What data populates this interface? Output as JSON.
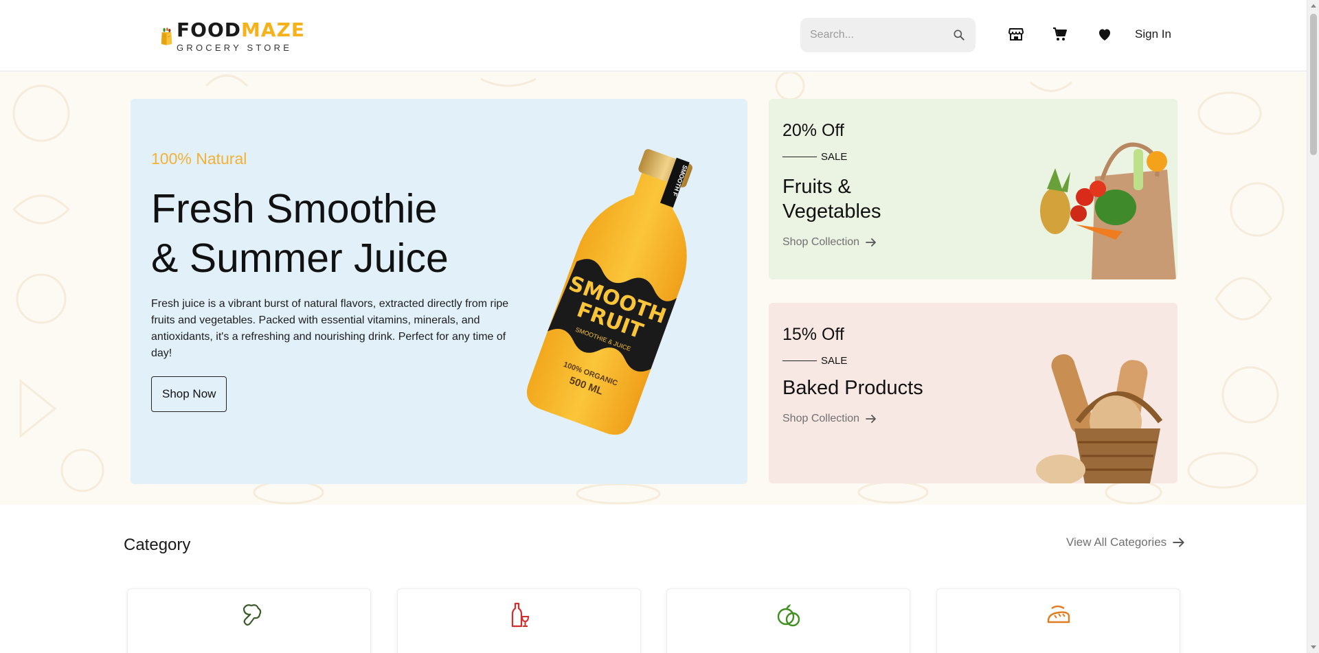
{
  "header": {
    "logo": {
      "title_part1": "FOOD",
      "title_part2": "MAZE",
      "subtitle": "GROCERY STORE"
    },
    "search": {
      "placeholder": "Search...",
      "value": ""
    },
    "icons": [
      "store-icon",
      "cart-icon",
      "heart-icon"
    ],
    "signin_label": "Sign In"
  },
  "hero": {
    "kicker": "100% Natural",
    "title_line1": "Fresh Smoothie",
    "title_line2": "& Summer Juice",
    "description": "Fresh juice is a vibrant burst of natural flavors, extracted directly from ripe fruits and vegetables. Packed with essential vitamins, minerals, and antioxidants, it's a refreshing and nourishing drink. Perfect for any time of day!",
    "button_label": "Shop Now",
    "bottle": {
      "brand_line1": "SMOOTH",
      "brand_line2": "FRUIT",
      "tagline": "SMOOTHIE & JUICE",
      "organic": "100% ORGANIC",
      "volume": "500 ML",
      "cap_label": "SMOOTH F"
    }
  },
  "promos": [
    {
      "discount": "20% Off",
      "sale": "SALE",
      "title": "Fruits & Vegetables",
      "link": "Shop Collection",
      "bg": "#ebf3e3"
    },
    {
      "discount": "15% Off",
      "sale": "SALE",
      "title": "Baked Products",
      "link": "Shop Collection",
      "bg": "#f8e8e4"
    }
  ],
  "category": {
    "title": "Category",
    "view_all": "View All Categories",
    "cards": [
      {
        "icon": "broccoli-icon",
        "color": "#3b5b2a"
      },
      {
        "icon": "wine-bottle-icon",
        "color": "#d42b2b"
      },
      {
        "icon": "apple-icon",
        "color": "#3f8f1f"
      },
      {
        "icon": "bread-icon",
        "color": "#e07b1f"
      }
    ]
  },
  "colors": {
    "accent": "#f3b234",
    "hero_bg": "#e1f0f9",
    "band_bg": "#fdf9f3"
  }
}
